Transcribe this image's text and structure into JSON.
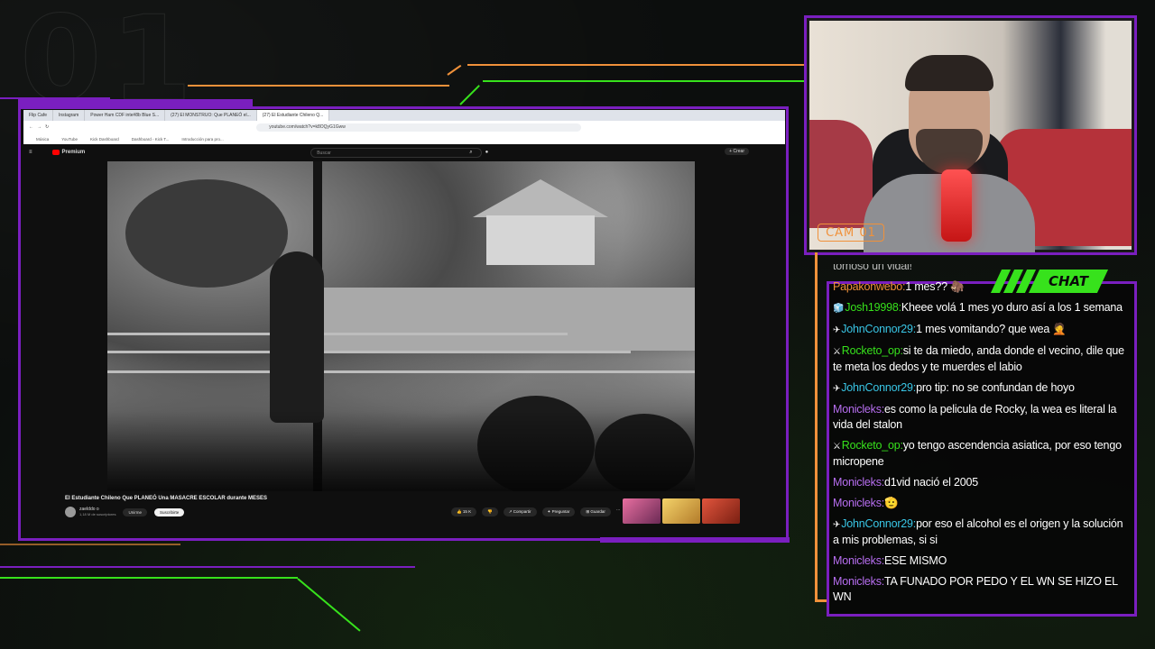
{
  "overlay": {
    "background_number": "01",
    "accent_purple": "#7a1fbf",
    "accent_green": "#37e21c",
    "accent_orange": "#f0913a",
    "cam_label": "CAM 01",
    "chat_label": "CHAT"
  },
  "browser": {
    "tabs": [
      "Flip Cafe",
      "Instagram",
      "Power Ham CDF inte#8b Blue S...",
      "(27) El MONSTRUO: Que PLANEÓ el...",
      "(27) El Estudiante Chileno Q..."
    ],
    "active_tab_index": 4,
    "url": "youtube.com/watch?v=k8OQyG1Gww",
    "bookmarks": [
      "Música",
      "YouTube",
      "Kick Dashboard",
      "Dashboard - Kick T...",
      "Introducción para pro..."
    ]
  },
  "youtube": {
    "logo_text": "Premium",
    "search_placeholder": "Buscar",
    "create_label": "Crear",
    "video_title": "El Estudiante Chileno Que PLANEÓ Una MASACRE ESCOLAR durante MESES",
    "channel_name": "zaelddo o",
    "subscribers": "1,18 M de suscriptores",
    "join_label": "Unirme",
    "subscribed_label": "Suscribirte",
    "like_count": "15 K",
    "share_label": "Compartir",
    "ask_label": "Preguntar",
    "save_label": "Guardar",
    "thumb_colors": [
      "#e86fa0",
      "#f4d36a",
      "#e2553d"
    ]
  },
  "chat": {
    "messages": [
      {
        "user": "",
        "user_color": "#ffffff",
        "badge": "",
        "text": "tomoso un vidal!",
        "cut": true
      },
      {
        "user": "Papakonwebo:",
        "user_color": "#f0913a",
        "badge": "",
        "text": "1 mes?? 🦣"
      },
      {
        "user": "Josh19998:",
        "user_color": "#37e21c",
        "badge": "🧊",
        "text": "Kheee volá 1 mes yo duro así a los 1 semana"
      },
      {
        "user": "JohnConnor29:",
        "user_color": "#39c6e6",
        "badge": "✈",
        "text": "1 mes vomitando? que wea 🤦"
      },
      {
        "user": "Rocketo_op:",
        "user_color": "#37e21c",
        "badge": "⚔",
        "text": "si te da miedo, anda donde el vecino, dile que te meta los dedos y te muerdes el labio"
      },
      {
        "user": "JohnConnor29:",
        "user_color": "#39c6e6",
        "badge": "✈",
        "text": "pro tip: no se confundan de hoyo"
      },
      {
        "user": "Monicleks:",
        "user_color": "#b76ef0",
        "badge": "",
        "text": "es como la pelicula de Rocky, la wea es literal la vida del stalon"
      },
      {
        "user": "Rocketo_op:",
        "user_color": "#37e21c",
        "badge": "⚔",
        "text": "yo tengo ascendencia asiatica, por eso tengo micropene"
      },
      {
        "user": "Monicleks:",
        "user_color": "#b76ef0",
        "badge": "",
        "text": "d1vid nació el 2005"
      },
      {
        "user": "Monicleks:",
        "user_color": "#b76ef0",
        "badge": "",
        "text": "🫡"
      },
      {
        "user": "JohnConnor29:",
        "user_color": "#39c6e6",
        "badge": "✈",
        "text": "por eso el alcohol es el origen y la solución a mis problemas, si si"
      },
      {
        "user": "Monicleks:",
        "user_color": "#b76ef0",
        "badge": "",
        "text": "ESE MISMO"
      },
      {
        "user": "Monicleks:",
        "user_color": "#b76ef0",
        "badge": "",
        "text": "TA FUNADO POR PEDO Y EL WN SE HIZO EL WN"
      }
    ]
  }
}
